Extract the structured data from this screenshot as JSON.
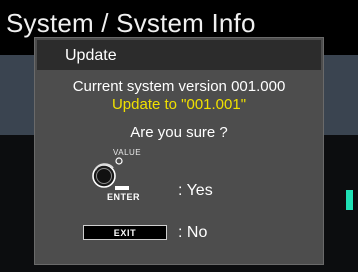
{
  "page": {
    "title": "System / Svstem Info"
  },
  "dialog": {
    "title": "Update",
    "current_version_text": "Current system version 001.000",
    "update_text": "Update to \"001.001\"",
    "confirm_text": "Are you sure ?",
    "value_label": "VALUE",
    "enter_label": "ENTER",
    "yes_text": ": Yes",
    "exit_label": "EXIT",
    "no_text": ": No"
  },
  "colors": {
    "dialog_bg": "#4d4d4d",
    "header_bg": "#2c2c2c",
    "highlight": "#f0e000",
    "accent": "#1fe0b5"
  },
  "icons": [
    "value-knob-icon",
    "enter-key-icon"
  ]
}
